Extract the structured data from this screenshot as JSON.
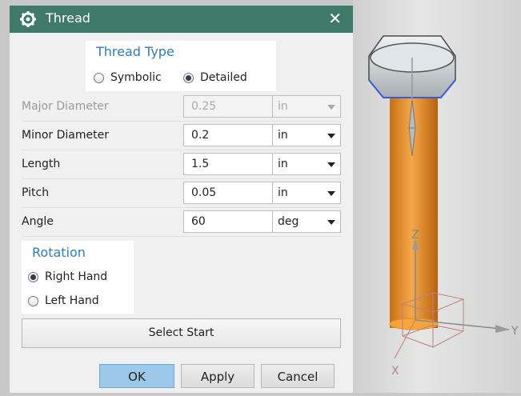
{
  "dialog": {
    "title": "Thread",
    "thread_type": {
      "title": "Thread Type",
      "options": [
        {
          "label": "Symbolic",
          "selected": false
        },
        {
          "label": "Detailed",
          "selected": true
        }
      ]
    },
    "fields": [
      {
        "label": "Major Diameter",
        "value": "0.25",
        "unit": "in",
        "enabled": false
      },
      {
        "label": "Minor Diameter",
        "value": "0.2",
        "unit": "in",
        "enabled": true
      },
      {
        "label": "Length",
        "value": "1.5",
        "unit": "in",
        "enabled": true
      },
      {
        "label": "Pitch",
        "value": "0.05",
        "unit": "in",
        "enabled": true
      },
      {
        "label": "Angle",
        "value": "60",
        "unit": "deg",
        "enabled": true
      }
    ],
    "rotation": {
      "title": "Rotation",
      "options": [
        {
          "label": "Right Hand",
          "selected": true
        },
        {
          "label": "Left Hand",
          "selected": false
        }
      ]
    },
    "select_start_label": "Select Start",
    "buttons": {
      "ok": "OK",
      "apply": "Apply",
      "cancel": "Cancel"
    }
  },
  "viewport": {
    "axes": {
      "z": "Z",
      "y": "Y",
      "x": "X"
    },
    "colors": {
      "shaft": "#e8902a",
      "head": "#dfe4e8",
      "axis": "#c08080"
    }
  },
  "colors": {
    "titlebar": "#3e7a67",
    "accent": "#2d7cc0",
    "ok_button": "#9cc8ea"
  }
}
